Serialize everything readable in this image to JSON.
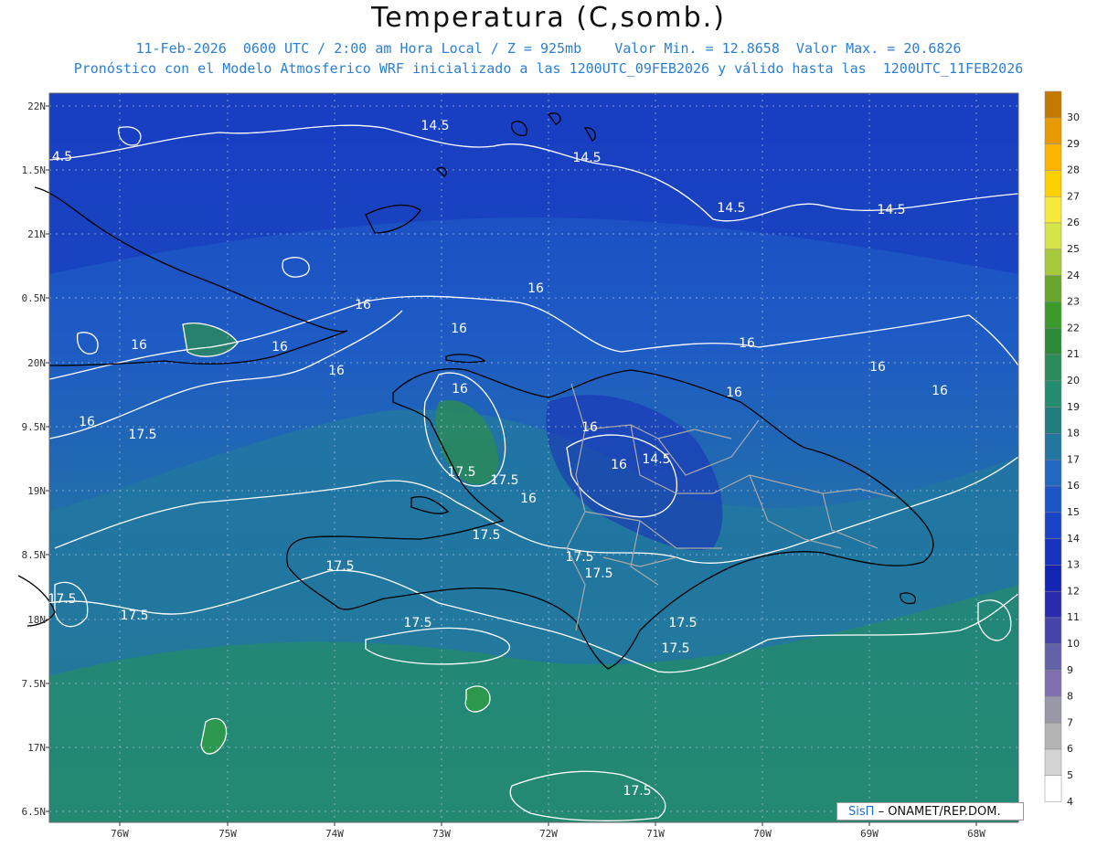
{
  "title": "Temperatura (C,somb.)",
  "subtitle_1": "11-Feb-2026  0600 UTC / 2:00 am Hora Local / Z = 925mb    Valor Min. = 12.8658  Valor Max. = 20.6826",
  "subtitle_2": "Pronóstico con el Modelo Atmosferico WRF inicializado a las 1200UTC_09FEB2026 y válido hasta las  1200UTC_11FEB2026",
  "lat_ticks": [
    "22N",
    "1.5N",
    "21N",
    "0.5N",
    "20N",
    "9.5N",
    "19N",
    "8.5N",
    "18N",
    "7.5N",
    "17N",
    "6.5N"
  ],
  "lon_ticks": [
    "76W",
    "75W",
    "74W",
    "73W",
    "72W",
    "71W",
    "70W",
    "69W",
    "68W"
  ],
  "colorbar": {
    "levels": [
      "30",
      "29",
      "28",
      "27",
      "26",
      "25",
      "24",
      "23",
      "22",
      "21",
      "20",
      "19",
      "18",
      "17",
      "16",
      "15",
      "14",
      "13",
      "12",
      "11",
      "10",
      "9",
      "8",
      "7",
      "6",
      "5",
      "4"
    ],
    "colors": [
      "#c47a00",
      "#e89a00",
      "#ffb400",
      "#ffd000",
      "#f5e93a",
      "#d6e64a",
      "#a7c93c",
      "#6aa530",
      "#3c9a2c",
      "#2e8a3a",
      "#2a8a5a",
      "#248c6e",
      "#227e7c",
      "#2276a0",
      "#2268c0",
      "#1c55c8",
      "#1a44c8",
      "#1733c0",
      "#1424b4",
      "#2a2ab0",
      "#4444aa",
      "#6262a8",
      "#8070b0",
      "#9898a8",
      "#b4b4b4",
      "#d4d4d4",
      "#ffffff"
    ]
  },
  "contour_labels": [
    {
      "text": "14.5"
    },
    {
      "text": "14.5"
    },
    {
      "text": "14.5"
    },
    {
      "text": "14.5"
    },
    {
      "text": "4.5"
    },
    {
      "text": "14.5"
    },
    {
      "text": "16"
    },
    {
      "text": "16"
    },
    {
      "text": "16"
    },
    {
      "text": "16"
    },
    {
      "text": "16"
    },
    {
      "text": "16"
    },
    {
      "text": "16"
    },
    {
      "text": "16"
    },
    {
      "text": "16"
    },
    {
      "text": "16"
    },
    {
      "text": "16"
    },
    {
      "text": "16"
    },
    {
      "text": "16"
    },
    {
      "text": "16"
    },
    {
      "text": "16"
    },
    {
      "text": "17.5"
    },
    {
      "text": "17.5"
    },
    {
      "text": "17.5"
    },
    {
      "text": "17.5"
    },
    {
      "text": "17.5"
    },
    {
      "text": "17.5"
    },
    {
      "text": "17.5"
    },
    {
      "text": "17.5"
    },
    {
      "text": "17.5"
    },
    {
      "text": "17.5"
    },
    {
      "text": "17.5"
    },
    {
      "text": "17.5"
    },
    {
      "text": "17.5"
    }
  ],
  "credit": {
    "logo": "SisΠ",
    "text": "– ONAMET/REP.DOM."
  }
}
